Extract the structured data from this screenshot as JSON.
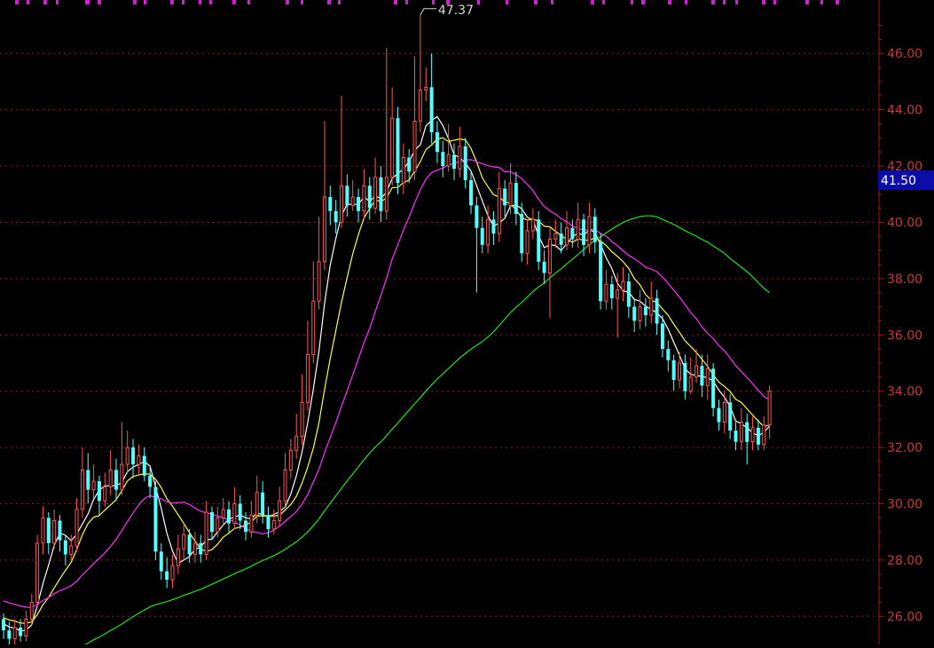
{
  "chart_data": {
    "type": "candlestick",
    "ylim": [
      25.0,
      47.9
    ],
    "y_ticks": [
      "46.00",
      "44.00",
      "42.00",
      "40.00",
      "38.00",
      "36.00",
      "34.00",
      "32.00",
      "30.00",
      "28.00",
      "26.00"
    ],
    "current_price_label": "41.50",
    "current_price": 41.5,
    "high_label": "47.37",
    "high_value": 47.37,
    "high_index": 74,
    "grid": true,
    "colors": {
      "background": "#000000",
      "grid": "#8b1a1a",
      "axis": "#a01818",
      "tick_text": "#c83838",
      "up": "#ff5555",
      "down": "#54ffff",
      "label_box": "#0c0ca8",
      "label_text": "#ffffff",
      "ma_white": "#ffffff",
      "ma_yellow": "#ffff40",
      "ma_magenta": "#ff30ff",
      "ma_green": "#20e020",
      "top_marks": "#d020d0"
    },
    "candles": [
      [
        25.9,
        25.5,
        26.1,
        25.2
      ],
      [
        25.5,
        25.2,
        25.8,
        24.9
      ],
      [
        25.2,
        25.6,
        25.9,
        25.0
      ],
      [
        25.6,
        25.3,
        25.9,
        25.1
      ],
      [
        25.3,
        25.9,
        26.2,
        25.1
      ],
      [
        25.9,
        26.5,
        26.8,
        25.7
      ],
      [
        26.5,
        28.6,
        28.9,
        26.3
      ],
      [
        28.6,
        29.5,
        29.9,
        28.2
      ],
      [
        29.5,
        28.6,
        29.7,
        28.2
      ],
      [
        28.6,
        29.4,
        29.8,
        28.4
      ],
      [
        29.4,
        28.7,
        29.6,
        28.3
      ],
      [
        28.7,
        28.2,
        28.9,
        27.8
      ],
      [
        28.2,
        28.5,
        28.9,
        28.0
      ],
      [
        28.5,
        29.8,
        30.2,
        28.3
      ],
      [
        29.8,
        31.2,
        32.0,
        29.5
      ],
      [
        31.2,
        30.5,
        31.8,
        30.0
      ],
      [
        30.5,
        30.8,
        31.4,
        30.2
      ],
      [
        30.8,
        30.1,
        31.0,
        29.6
      ],
      [
        30.1,
        30.6,
        31.1,
        29.9
      ],
      [
        30.6,
        31.2,
        31.9,
        30.3
      ],
      [
        31.2,
        30.5,
        31.6,
        30.1
      ],
      [
        30.5,
        31.4,
        32.9,
        30.3
      ],
      [
        31.4,
        32.0,
        32.6,
        31.1
      ],
      [
        32.0,
        31.4,
        32.3,
        30.9
      ],
      [
        31.4,
        31.7,
        32.1,
        31.0
      ],
      [
        31.7,
        31.0,
        32.0,
        30.8
      ],
      [
        31.0,
        30.6,
        31.3,
        30.2
      ],
      [
        30.6,
        28.3,
        30.8,
        28.0
      ],
      [
        28.3,
        27.6,
        28.6,
        27.3
      ],
      [
        27.6,
        27.3,
        28.1,
        27.0
      ],
      [
        27.3,
        27.8,
        28.2,
        27.0
      ],
      [
        27.8,
        28.4,
        28.9,
        27.5
      ],
      [
        28.4,
        28.9,
        29.3,
        28.0
      ],
      [
        28.9,
        28.2,
        29.1,
        27.9
      ],
      [
        28.2,
        28.6,
        29.0,
        27.9
      ],
      [
        28.6,
        28.2,
        28.9,
        27.9
      ],
      [
        28.2,
        29.7,
        30.1,
        28.0
      ],
      [
        29.7,
        29.0,
        29.9,
        28.7
      ],
      [
        29.0,
        29.5,
        29.9,
        28.8
      ],
      [
        29.5,
        29.8,
        30.2,
        29.2
      ],
      [
        29.8,
        29.3,
        30.1,
        29.0
      ],
      [
        29.3,
        30.0,
        30.6,
        29.1
      ],
      [
        30.0,
        29.4,
        30.3,
        29.1
      ],
      [
        29.4,
        29.0,
        29.7,
        28.7
      ],
      [
        29.0,
        29.6,
        30.1,
        28.8
      ],
      [
        29.6,
        30.4,
        31.0,
        29.3
      ],
      [
        30.4,
        29.6,
        30.8,
        29.3
      ],
      [
        29.6,
        29.1,
        29.9,
        28.8
      ],
      [
        29.1,
        29.4,
        29.8,
        28.9
      ],
      [
        29.4,
        30.1,
        30.6,
        29.2
      ],
      [
        30.1,
        31.2,
        31.8,
        29.9
      ],
      [
        31.2,
        31.9,
        32.3,
        30.9
      ],
      [
        31.9,
        32.4,
        33.2,
        31.6
      ],
      [
        32.4,
        33.6,
        34.6,
        32.1
      ],
      [
        33.6,
        35.3,
        36.5,
        33.3
      ],
      [
        35.3,
        37.2,
        38.6,
        35.0
      ],
      [
        37.2,
        38.6,
        40.2,
        36.9
      ],
      [
        38.6,
        40.9,
        43.6,
        38.3
      ],
      [
        40.9,
        40.4,
        41.3,
        39.9
      ],
      [
        40.4,
        40.0,
        40.8,
        39.6
      ],
      [
        40.0,
        41.3,
        44.5,
        39.8
      ],
      [
        41.3,
        40.6,
        41.7,
        40.2
      ],
      [
        40.6,
        40.9,
        41.5,
        40.4
      ],
      [
        40.9,
        40.4,
        41.2,
        40.0
      ],
      [
        40.4,
        41.3,
        41.9,
        40.1
      ],
      [
        41.3,
        40.5,
        41.6,
        40.1
      ],
      [
        40.5,
        41.6,
        42.3,
        40.3
      ],
      [
        41.6,
        40.4,
        42.0,
        40.0
      ],
      [
        40.4,
        41.6,
        46.2,
        40.1
      ],
      [
        41.6,
        43.7,
        44.8,
        41.3
      ],
      [
        43.7,
        41.4,
        44.1,
        41.0
      ],
      [
        41.4,
        42.3,
        42.8,
        41.0
      ],
      [
        42.3,
        41.8,
        42.6,
        41.4
      ],
      [
        41.8,
        43.6,
        45.9,
        41.5
      ],
      [
        43.6,
        44.7,
        47.37,
        43.2
      ],
      [
        44.7,
        44.8,
        45.5,
        44.3
      ],
      [
        44.8,
        43.2,
        46.0,
        42.8
      ],
      [
        43.2,
        42.5,
        43.6,
        42.1
      ],
      [
        42.5,
        42.0,
        42.9,
        41.6
      ],
      [
        42.0,
        42.4,
        43.5,
        41.8
      ],
      [
        42.4,
        41.9,
        42.8,
        41.5
      ],
      [
        41.9,
        42.7,
        43.4,
        41.6
      ],
      [
        42.7,
        41.5,
        43.0,
        41.2
      ],
      [
        41.5,
        40.6,
        41.8,
        40.3
      ],
      [
        40.6,
        39.8,
        40.9,
        37.5
      ],
      [
        39.8,
        39.2,
        40.2,
        38.9
      ],
      [
        39.2,
        40.1,
        40.6,
        38.9
      ],
      [
        40.1,
        39.6,
        40.4,
        39.2
      ],
      [
        39.6,
        41.2,
        41.8,
        39.3
      ],
      [
        41.2,
        40.6,
        41.5,
        40.2
      ],
      [
        40.6,
        41.4,
        42.1,
        40.3
      ],
      [
        41.4,
        40.3,
        41.8,
        39.9
      ],
      [
        40.3,
        38.9,
        40.7,
        38.6
      ],
      [
        38.9,
        39.7,
        40.1,
        38.5
      ],
      [
        39.7,
        40.1,
        40.5,
        39.4
      ],
      [
        40.1,
        38.6,
        40.4,
        38.3
      ],
      [
        38.6,
        38.2,
        39.0,
        37.8
      ],
      [
        38.2,
        39.4,
        39.8,
        36.6
      ],
      [
        39.4,
        39.6,
        40.1,
        39.1
      ],
      [
        39.6,
        39.2,
        40.0,
        38.9
      ],
      [
        39.2,
        39.8,
        40.4,
        39.0
      ],
      [
        39.8,
        39.4,
        40.1,
        39.1
      ],
      [
        39.4,
        40.1,
        40.7,
        39.1
      ],
      [
        40.1,
        39.2,
        40.3,
        38.8
      ],
      [
        39.2,
        40.2,
        40.7,
        38.9
      ],
      [
        40.2,
        39.3,
        40.5,
        38.9
      ],
      [
        39.3,
        37.2,
        39.6,
        36.9
      ],
      [
        37.2,
        37.8,
        38.3,
        36.9
      ],
      [
        37.8,
        37.3,
        38.1,
        36.9
      ],
      [
        37.3,
        37.6,
        38.2,
        35.9
      ],
      [
        37.6,
        37.9,
        38.4,
        37.2
      ],
      [
        37.9,
        37.0,
        38.2,
        36.6
      ],
      [
        37.0,
        36.5,
        37.3,
        36.1
      ],
      [
        36.5,
        37.0,
        37.6,
        36.2
      ],
      [
        37.0,
        36.7,
        37.3,
        36.3
      ],
      [
        36.7,
        37.3,
        37.9,
        36.4
      ],
      [
        37.3,
        36.4,
        37.6,
        36.0
      ],
      [
        36.4,
        35.5,
        36.7,
        35.2
      ],
      [
        35.5,
        35.1,
        35.8,
        34.7
      ],
      [
        35.1,
        34.4,
        35.3,
        34.0
      ],
      [
        34.4,
        35.0,
        35.4,
        34.1
      ],
      [
        35.0,
        34.0,
        35.3,
        33.7
      ],
      [
        34.0,
        34.5,
        35.2,
        33.9
      ],
      [
        34.5,
        34.9,
        35.5,
        34.3
      ],
      [
        34.9,
        34.2,
        35.3,
        33.8
      ],
      [
        34.2,
        34.8,
        35.3,
        33.7
      ],
      [
        34.8,
        33.4,
        35.0,
        33.1
      ],
      [
        33.4,
        32.9,
        33.7,
        32.6
      ],
      [
        32.9,
        33.6,
        34.0,
        32.5
      ],
      [
        33.6,
        32.6,
        33.9,
        32.3
      ],
      [
        32.6,
        32.2,
        32.9,
        31.9
      ],
      [
        32.2,
        32.9,
        33.4,
        31.9
      ],
      [
        32.9,
        32.2,
        33.2,
        31.4
      ],
      [
        32.2,
        32.7,
        33.1,
        31.9
      ],
      [
        32.7,
        32.1,
        33.0,
        31.9
      ],
      [
        32.1,
        32.8,
        33.1,
        31.9
      ],
      [
        32.8,
        34.0,
        34.2,
        32.3
      ]
    ]
  }
}
